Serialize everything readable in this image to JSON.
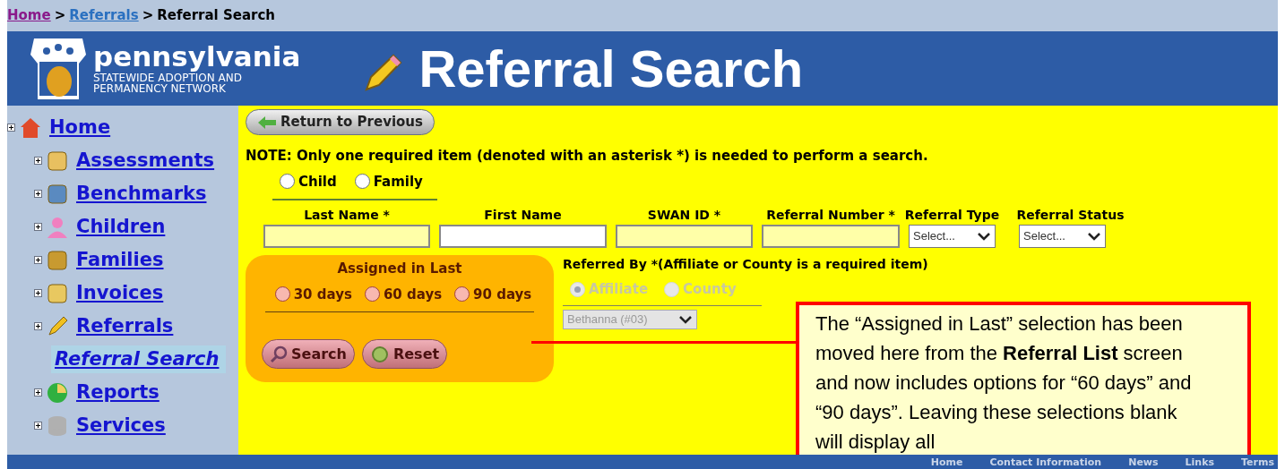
{
  "breadcrumb": [
    {
      "label": "Home",
      "kind": "visited"
    },
    {
      "label": "Referrals",
      "kind": "link"
    },
    {
      "label": "Referral Search",
      "kind": "current"
    }
  ],
  "breadcrumb_separator": ">",
  "header": {
    "logo_title": "pennsylvania",
    "logo_subtitle_1": "STATEWIDE ADOPTION AND",
    "logo_subtitle_2": "PERMANENCY NETWORK",
    "page_title": "Referral Search"
  },
  "sidebar": {
    "items": [
      {
        "label": "Home",
        "selected": false,
        "children": [
          {
            "label": "Assessments",
            "selected": false
          },
          {
            "label": "Benchmarks",
            "selected": false
          },
          {
            "label": "Children",
            "selected": false
          },
          {
            "label": "Families",
            "selected": false
          },
          {
            "label": "Invoices",
            "selected": false
          },
          {
            "label": "Referrals",
            "selected": false,
            "children": [
              {
                "label": "Referral Search",
                "selected": true
              }
            ]
          },
          {
            "label": "Reports",
            "selected": false
          },
          {
            "label": "Services",
            "selected": false
          }
        ]
      }
    ]
  },
  "return_button": "Return to Previous",
  "note": "NOTE: Only one required item (denoted with an asterisk *) is needed to perform a search.",
  "subject_options": [
    {
      "label": "Child",
      "selected": false
    },
    {
      "label": "Family",
      "selected": false
    }
  ],
  "fields": [
    {
      "label": "Last Name *",
      "kind": "text",
      "required": true
    },
    {
      "label": "First Name",
      "kind": "text",
      "required": false
    },
    {
      "label": "SWAN ID *",
      "kind": "text",
      "required": true
    },
    {
      "label": "Referral Number *",
      "kind": "text",
      "required": true
    },
    {
      "label": "Referral Type",
      "kind": "select",
      "value": "Select..."
    },
    {
      "label": "Referral Status",
      "kind": "select",
      "value": "Select..."
    }
  ],
  "assigned": {
    "title": "Assigned in Last",
    "options": [
      {
        "label": "30 days",
        "selected": false
      },
      {
        "label": "60 days",
        "selected": false
      },
      {
        "label": "90 days",
        "selected": false
      }
    ]
  },
  "referred_by": {
    "title": "Referred By *(Affiliate or County is a required item)",
    "options": [
      {
        "label": "Affiliate",
        "selected": true,
        "disabled": true
      },
      {
        "label": "County",
        "selected": false,
        "disabled": true
      }
    ],
    "agency": {
      "value": "Bethanna (#03)",
      "disabled": true
    }
  },
  "buttons": [
    {
      "label": "Search"
    },
    {
      "label": "Reset"
    }
  ],
  "callout": "The “Assigned in Last” selection has been moved here from the **Referral List** screen and now includes options for “60 days” and “90 days”. Leaving these selections blank will display all",
  "footer_links": [
    "Home",
    "Contact Information",
    "News",
    "Links",
    "Terms"
  ]
}
